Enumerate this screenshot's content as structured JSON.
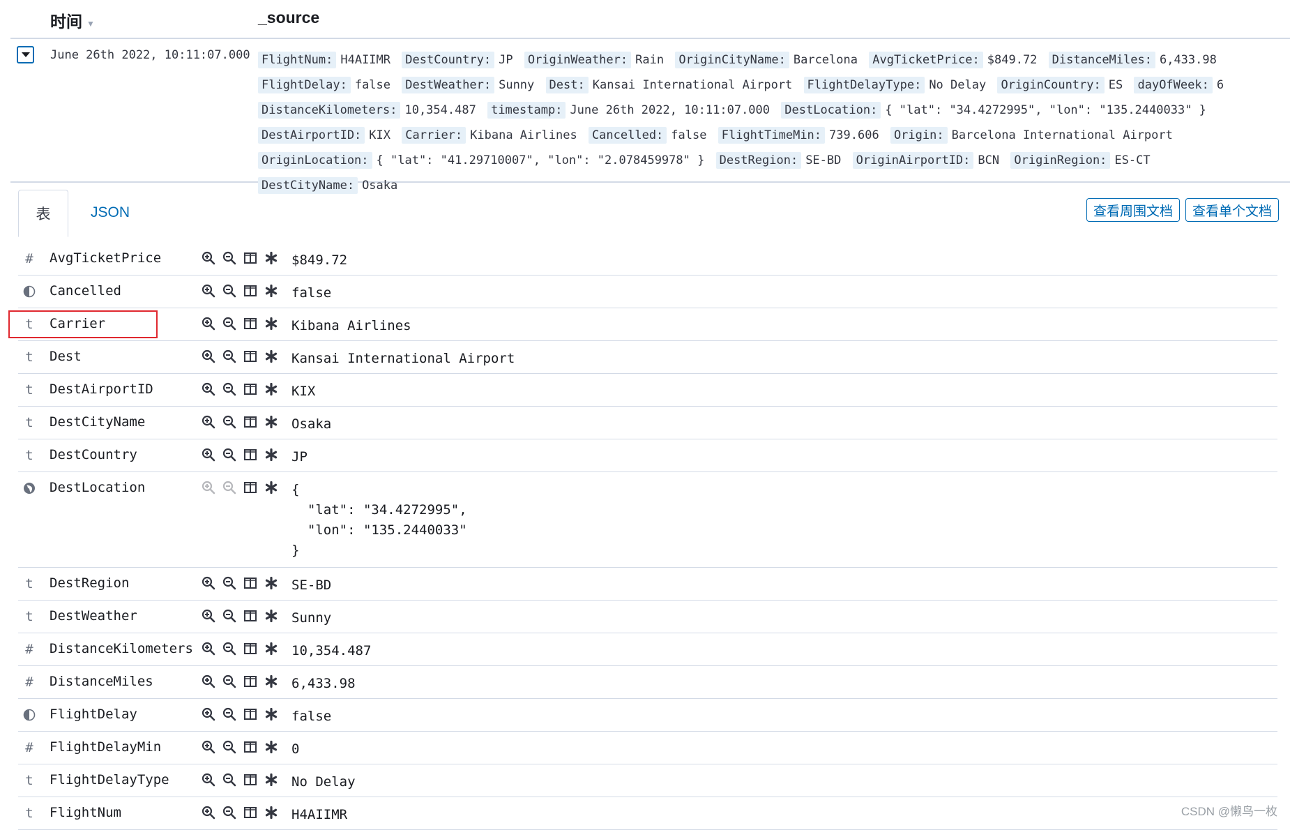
{
  "header": {
    "time_col": "时间",
    "source_col": "_source"
  },
  "document": {
    "timestamp": "June 26th 2022, 10:11:07.000",
    "source_pairs": [
      {
        "key": "FlightNum:",
        "value": "H4AIIMR"
      },
      {
        "key": "DestCountry:",
        "value": "JP"
      },
      {
        "key": "OriginWeather:",
        "value": "Rain"
      },
      {
        "key": "OriginCityName:",
        "value": "Barcelona"
      },
      {
        "key": "AvgTicketPrice:",
        "value": "$849.72"
      },
      {
        "key": "DistanceMiles:",
        "value": "6,433.98"
      },
      {
        "key": "FlightDelay:",
        "value": "false"
      },
      {
        "key": "DestWeather:",
        "value": "Sunny"
      },
      {
        "key": "Dest:",
        "value": "Kansai International Airport"
      },
      {
        "key": "FlightDelayType:",
        "value": "No Delay"
      },
      {
        "key": "OriginCountry:",
        "value": "ES"
      },
      {
        "key": "dayOfWeek:",
        "value": "6"
      },
      {
        "key": "DistanceKilometers:",
        "value": "10,354.487"
      },
      {
        "key": "timestamp:",
        "value": "June 26th 2022, 10:11:07.000"
      },
      {
        "key": "DestLocation:",
        "value": "{ \"lat\": \"34.4272995\", \"lon\": \"135.2440033\" }"
      },
      {
        "key": "DestAirportID:",
        "value": "KIX"
      },
      {
        "key": "Carrier:",
        "value": "Kibana Airlines"
      },
      {
        "key": "Cancelled:",
        "value": "false"
      },
      {
        "key": "FlightTimeMin:",
        "value": "739.606"
      },
      {
        "key": "Origin:",
        "value": "Barcelona International Airport"
      },
      {
        "key": "OriginLocation:",
        "value": "{ \"lat\": \"41.29710007\", \"lon\": \"2.078459978\" }"
      },
      {
        "key": "DestRegion:",
        "value": "SE-BD"
      },
      {
        "key": "OriginAirportID:",
        "value": "BCN"
      },
      {
        "key": "OriginRegion:",
        "value": "ES-CT"
      },
      {
        "key": "DestCityName:",
        "value": "Osaka"
      }
    ]
  },
  "tabs": [
    {
      "label": "表",
      "active": true
    },
    {
      "label": "JSON",
      "active": false
    }
  ],
  "buttons": {
    "surrounding": "查看周围文档",
    "single": "查看单个文档"
  },
  "fields": [
    {
      "type": "#",
      "type_icon": "number",
      "name": "AvgTicketPrice",
      "value": "$849.72"
    },
    {
      "type": "",
      "type_icon": "boolean",
      "name": "Cancelled",
      "value": "false"
    },
    {
      "type": "t",
      "type_icon": "string",
      "name": "Carrier",
      "value": "Kibana Airlines",
      "highlighted": true
    },
    {
      "type": "t",
      "type_icon": "string",
      "name": "Dest",
      "value": "Kansai International Airport"
    },
    {
      "type": "t",
      "type_icon": "string",
      "name": "DestAirportID",
      "value": "KIX"
    },
    {
      "type": "t",
      "type_icon": "string",
      "name": "DestCityName",
      "value": "Osaka"
    },
    {
      "type": "t",
      "type_icon": "string",
      "name": "DestCountry",
      "value": "JP"
    },
    {
      "type": "",
      "type_icon": "geo",
      "name": "DestLocation",
      "value": "{\n  \"lat\": \"34.4272995\",\n  \"lon\": \"135.2440033\"\n}",
      "filters_disabled": true
    },
    {
      "type": "t",
      "type_icon": "string",
      "name": "DestRegion",
      "value": "SE-BD"
    },
    {
      "type": "t",
      "type_icon": "string",
      "name": "DestWeather",
      "value": "Sunny"
    },
    {
      "type": "#",
      "type_icon": "number",
      "name": "DistanceKilometers",
      "value": "10,354.487"
    },
    {
      "type": "#",
      "type_icon": "number",
      "name": "DistanceMiles",
      "value": "6,433.98"
    },
    {
      "type": "",
      "type_icon": "boolean",
      "name": "FlightDelay",
      "value": "false"
    },
    {
      "type": "#",
      "type_icon": "number",
      "name": "FlightDelayMin",
      "value": "0"
    },
    {
      "type": "t",
      "type_icon": "string",
      "name": "FlightDelayType",
      "value": "No Delay"
    },
    {
      "type": "t",
      "type_icon": "string",
      "name": "FlightNum",
      "value": "H4AIIMR"
    }
  ],
  "watermark": "CSDN @懒鸟一枚",
  "colors": {
    "link": "#006bb4",
    "key_bg": "#e6f0f8",
    "highlight": "#e0282f",
    "border": "#d3dae6"
  }
}
